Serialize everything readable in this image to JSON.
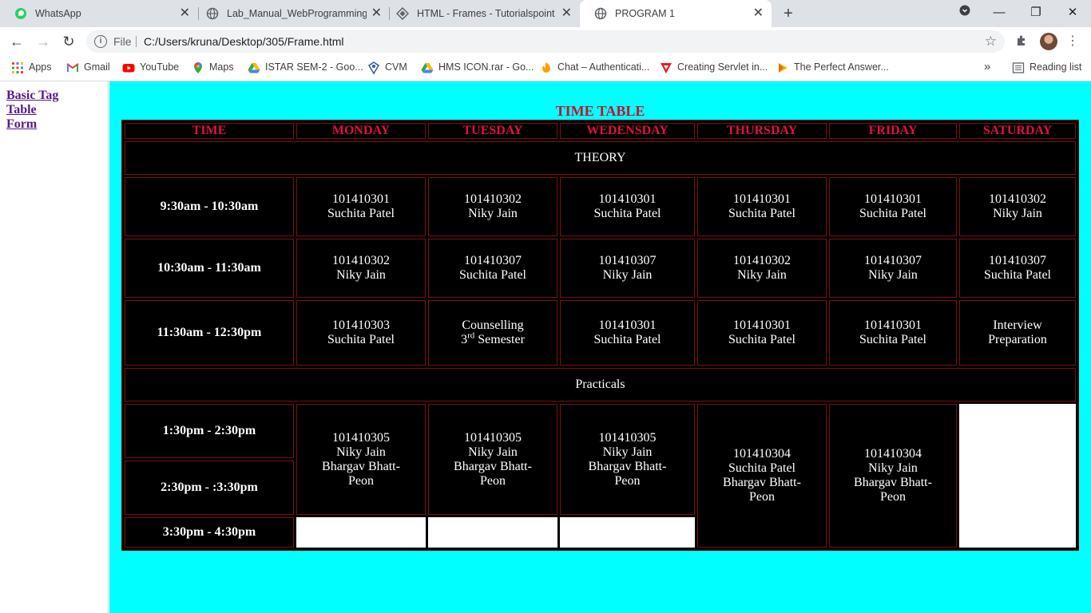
{
  "browser": {
    "tabs": [
      {
        "title": "WhatsApp",
        "icon": "whatsapp-icon"
      },
      {
        "title": "Lab_Manual_WebProgramming_F",
        "icon": "globe-icon"
      },
      {
        "title": "HTML - Frames - Tutorialspoint",
        "icon": "tutorialspoint-icon"
      },
      {
        "title": "PROGRAM 1",
        "icon": "globe-icon",
        "active": true
      }
    ],
    "address": {
      "scheme": "File",
      "url": "C:/Users/kruna/Desktop/305/Frame.html"
    },
    "bookmarks": [
      {
        "label": "Apps",
        "icon": "apps-grid-icon"
      },
      {
        "label": "Gmail",
        "icon": "gmail-icon"
      },
      {
        "label": "YouTube",
        "icon": "youtube-icon"
      },
      {
        "label": "Maps",
        "icon": "maps-pin-icon"
      },
      {
        "label": "ISTAR SEM-2 - Goo...",
        "icon": "google-drive-icon"
      },
      {
        "label": "CVM",
        "icon": "cvm-icon"
      },
      {
        "label": "HMS ICON.rar - Go...",
        "icon": "google-drive-icon"
      },
      {
        "label": "Chat – Authenticati...",
        "icon": "chat-flame-icon"
      },
      {
        "label": "Creating Servlet in...",
        "icon": "javatpoint-icon"
      },
      {
        "label": "The Perfect Answer...",
        "icon": "play-arrow-icon"
      }
    ],
    "reading_list": "Reading list",
    "colors": {
      "tabstrip": "#dee1e6",
      "page_bg": "#00ffff"
    }
  },
  "nav": {
    "links": [
      "Basic Tag",
      "Table",
      "Form"
    ]
  },
  "timetable": {
    "caption": "TIME TABLE",
    "headers": [
      "TIME",
      "MONDAY",
      "TUESDAY",
      "WEDENSDAY",
      "THURSDAY",
      "FRIDAY",
      "SATURDAY"
    ],
    "section_theory": "THEORY",
    "section_practicals": "Practicals",
    "theory_rows": [
      {
        "time": "9:30am - 10:30am",
        "cells": [
          [
            "101410301",
            "Suchita Patel"
          ],
          [
            "101410302",
            "Niky Jain"
          ],
          [
            "101410301",
            "Suchita Patel"
          ],
          [
            "101410301",
            "Suchita Patel"
          ],
          [
            "101410301",
            "Suchita Patel"
          ],
          [
            "101410302",
            "Niky Jain"
          ]
        ]
      },
      {
        "time": "10:30am - 11:30am",
        "cells": [
          [
            "101410302",
            "Niky Jain"
          ],
          [
            "101410307",
            "Suchita Patel"
          ],
          [
            "101410307",
            "Niky Jain"
          ],
          [
            "101410302",
            "Niky Jain"
          ],
          [
            "101410307",
            "Niky Jain"
          ],
          [
            "101410307",
            "Suchita Patel"
          ]
        ]
      },
      {
        "time": "11:30am - 12:30pm",
        "cells": [
          [
            "101410303",
            "Suchita Patel"
          ],
          [
            "Counselling",
            "3",
            "rd",
            "Semester"
          ],
          [
            "101410301",
            "Suchita Patel"
          ],
          [
            "101410301",
            "Suchita Patel"
          ],
          [
            "101410301",
            "Suchita Patel"
          ],
          [
            "Interview",
            "Preparation"
          ]
        ]
      }
    ],
    "practical_times": [
      "1:30pm - 2:30pm",
      "2:30pm - :3:30pm",
      "3:30pm - 4:30pm"
    ],
    "practical_cells": {
      "monday": [
        "101410305",
        "Niky Jain",
        "Bhargav Bhatt-",
        "Peon"
      ],
      "tuesday": [
        "101410305",
        "Niky Jain",
        "Bhargav Bhatt-",
        "Peon"
      ],
      "wednesday": [
        "101410305",
        "Niky Jain",
        "Bhargav Bhatt-",
        "Peon"
      ],
      "thursday": [
        "101410304",
        "Suchita Patel",
        "Bhargav Bhatt-",
        "Peon"
      ],
      "friday": [
        "101410304",
        "Niky Jain",
        "Bhargav Bhatt-",
        "Peon"
      ]
    }
  }
}
